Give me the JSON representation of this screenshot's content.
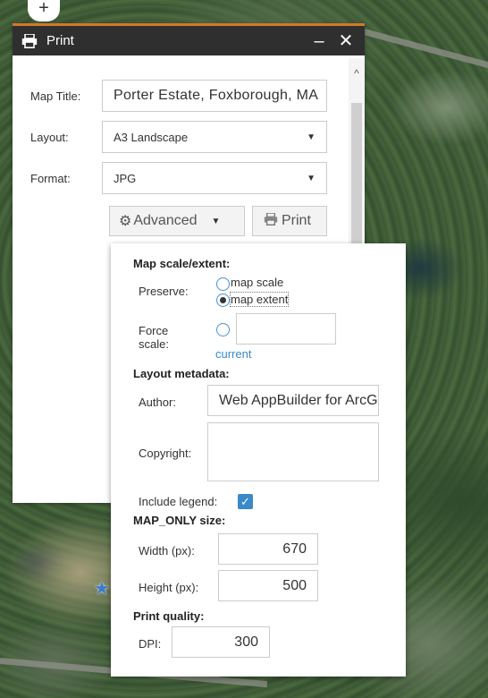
{
  "zoom": {
    "in_label": "+"
  },
  "panel": {
    "title": "Print",
    "minimize_label": "–",
    "close_label": "✕",
    "scroll_up_label": "^",
    "map_title_label": "Map Title:",
    "map_title_value": "Porter Estate, Foxborough, MA",
    "layout_label": "Layout:",
    "layout_value": "A3 Landscape",
    "format_label": "Format:",
    "format_value": "JPG",
    "advanced_label": "Advanced",
    "print_label": "Print"
  },
  "advanced": {
    "map_scale_heading": "Map scale/extent:",
    "preserve_label": "Preserve:",
    "preserve_options": [
      "map scale",
      "map extent"
    ],
    "preserve_selected": "map extent",
    "force_scale_label_1": "Force",
    "force_scale_label_2": "scale:",
    "force_scale_value": "",
    "current_link": "current",
    "layout_metadata_heading": "Layout metadata:",
    "author_label": "Author:",
    "author_value": "Web AppBuilder for ArcGIS",
    "copyright_label": "Copyright:",
    "copyright_value": "",
    "include_legend_label": "Include legend:",
    "include_legend_checked": true,
    "map_only_heading": "MAP_ONLY size:",
    "width_label": "Width (px):",
    "width_value": "670",
    "height_label": "Height (px):",
    "height_value": "500",
    "print_quality_heading": "Print quality:",
    "dpi_label": "DPI:",
    "dpi_value": "300"
  },
  "icons": {
    "print": "print-icon",
    "gear": "gear-icon",
    "caret": "chevron-down-icon",
    "marker": "location-marker-icon"
  },
  "colors": {
    "header_bg": "#2f2f2f",
    "accent_top": "#d4772a",
    "link": "#3a8ac9"
  }
}
